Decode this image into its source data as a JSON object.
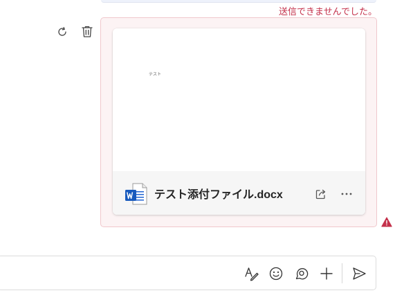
{
  "message": {
    "error_text": "送信できませんでした。",
    "attachment": {
      "file_name": "テスト添付ファイル.docx",
      "preview_text": "テスト",
      "file_type_icon": "word-doc-icon"
    },
    "actions": {
      "retry_icon": "retry-icon",
      "delete_icon": "trash-icon"
    },
    "status_icon": "warning-icon"
  },
  "compose": {
    "tools": [
      "format-icon",
      "emoji-icon",
      "loop-icon",
      "add-icon",
      "send-icon"
    ]
  },
  "colors": {
    "error": "#c4314b",
    "bubble_bg": "#fcf3f4",
    "bubble_border": "#f0c7cc",
    "word_blue": "#185abd"
  }
}
